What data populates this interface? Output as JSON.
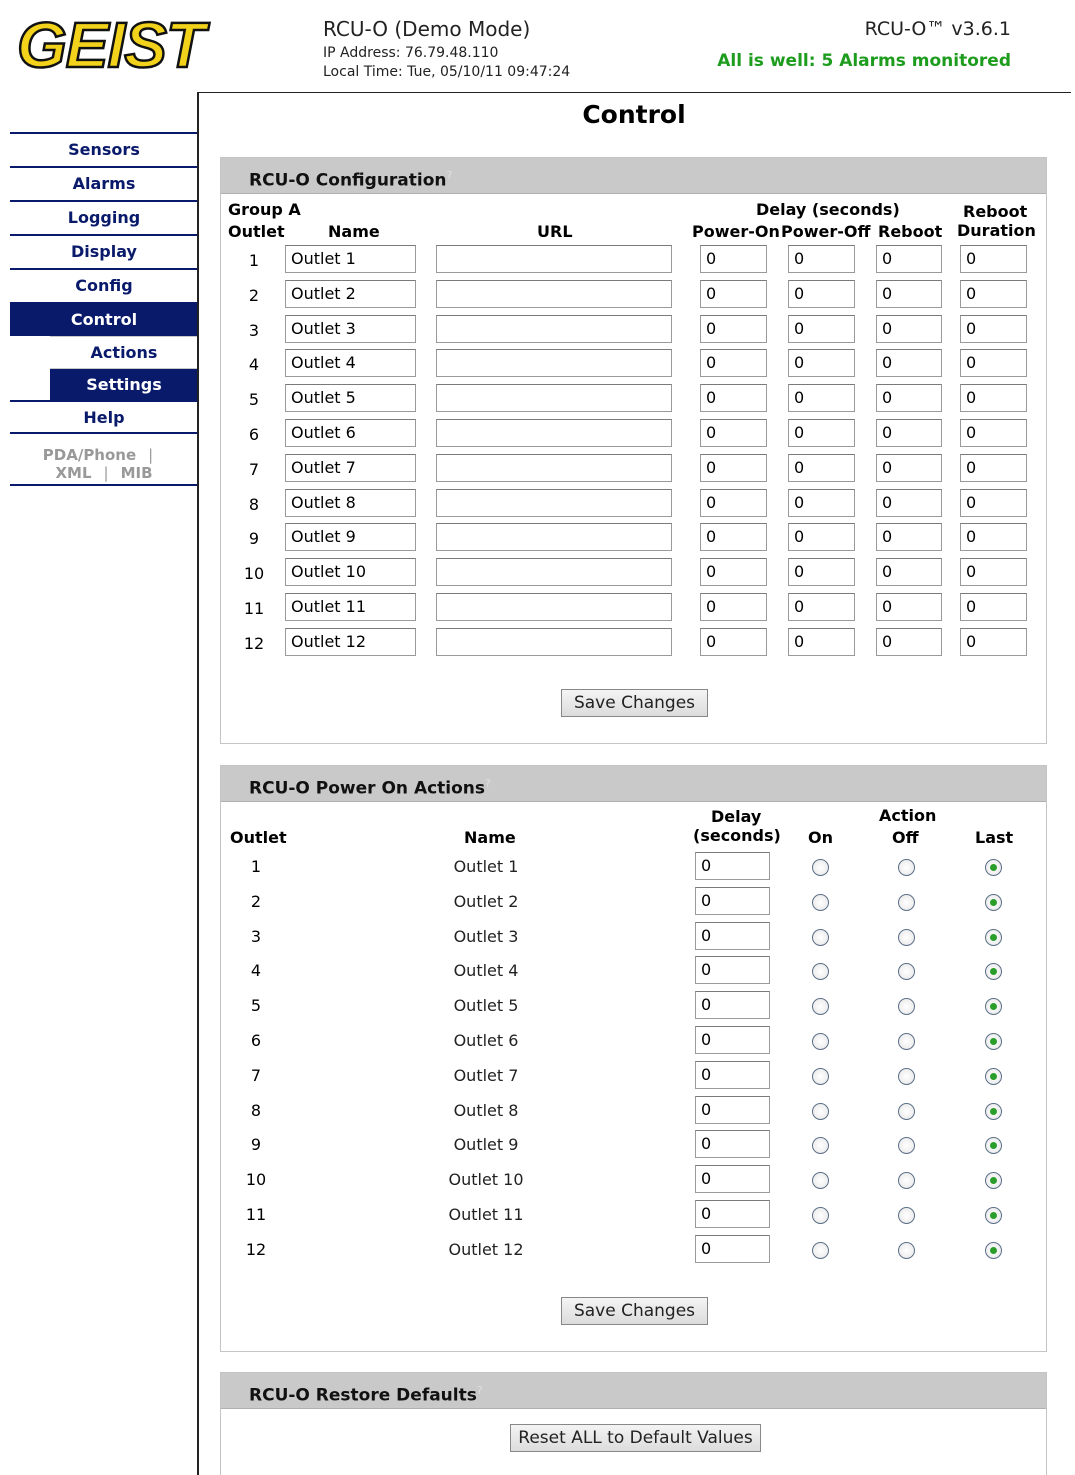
{
  "header": {
    "logo_text": "GEIST",
    "device_title": "RCU-O (Demo Mode)",
    "ip_label": "IP Address: 76.79.48.110",
    "local_time": "Local Time: Tue, 05/10/11 09:47:24",
    "version": "RCU-O™ v3.6.1",
    "status": "All is well: 5 Alarms monitored",
    "status_color": "#1e9c1e"
  },
  "nav": {
    "items": [
      "Sensors",
      "Alarms",
      "Logging",
      "Display",
      "Config",
      "Control"
    ],
    "active": "Control",
    "sub_items": [
      "Actions",
      "Settings"
    ],
    "active_sub": "Settings",
    "help": "Help",
    "pda": "PDA/Phone",
    "xml": "XML",
    "mib": "MIB",
    "sep": "|"
  },
  "page_title": "Control",
  "config": {
    "title": "RCU-O Configuration",
    "help_mark": "?",
    "headers": {
      "group": "Group A",
      "outlet": "Outlet",
      "name": "Name",
      "url": "URL",
      "delay": "Delay (seconds)",
      "power_on": "Power-On",
      "power_off": "Power-Off",
      "reboot": "Reboot",
      "reboot_dur_1": "Reboot",
      "reboot_dur_2": "Duration"
    },
    "rows": [
      {
        "num": "1",
        "name": "Outlet 1",
        "url": "",
        "on": "0",
        "off": "0",
        "reboot": "0",
        "dur": "0"
      },
      {
        "num": "2",
        "name": "Outlet 2",
        "url": "",
        "on": "0",
        "off": "0",
        "reboot": "0",
        "dur": "0"
      },
      {
        "num": "3",
        "name": "Outlet 3",
        "url": "",
        "on": "0",
        "off": "0",
        "reboot": "0",
        "dur": "0"
      },
      {
        "num": "4",
        "name": "Outlet 4",
        "url": "",
        "on": "0",
        "off": "0",
        "reboot": "0",
        "dur": "0"
      },
      {
        "num": "5",
        "name": "Outlet 5",
        "url": "",
        "on": "0",
        "off": "0",
        "reboot": "0",
        "dur": "0"
      },
      {
        "num": "6",
        "name": "Outlet 6",
        "url": "",
        "on": "0",
        "off": "0",
        "reboot": "0",
        "dur": "0"
      },
      {
        "num": "7",
        "name": "Outlet 7",
        "url": "",
        "on": "0",
        "off": "0",
        "reboot": "0",
        "dur": "0"
      },
      {
        "num": "8",
        "name": "Outlet 8",
        "url": "",
        "on": "0",
        "off": "0",
        "reboot": "0",
        "dur": "0"
      },
      {
        "num": "9",
        "name": "Outlet 9",
        "url": "",
        "on": "0",
        "off": "0",
        "reboot": "0",
        "dur": "0"
      },
      {
        "num": "10",
        "name": "Outlet 10",
        "url": "",
        "on": "0",
        "off": "0",
        "reboot": "0",
        "dur": "0"
      },
      {
        "num": "11",
        "name": "Outlet 11",
        "url": "",
        "on": "0",
        "off": "0",
        "reboot": "0",
        "dur": "0"
      },
      {
        "num": "12",
        "name": "Outlet 12",
        "url": "",
        "on": "0",
        "off": "0",
        "reboot": "0",
        "dur": "0"
      }
    ],
    "save_label": "Save Changes"
  },
  "power_on": {
    "title": "RCU-O Power On Actions",
    "help_mark": "?",
    "headers": {
      "outlet": "Outlet",
      "name": "Name",
      "delay_1": "Delay",
      "delay_2": "(seconds)",
      "action": "Action",
      "on": "On",
      "off": "Off",
      "last": "Last"
    },
    "rows": [
      {
        "num": "1",
        "name": "Outlet 1",
        "delay": "0",
        "action": "last"
      },
      {
        "num": "2",
        "name": "Outlet 2",
        "delay": "0",
        "action": "last"
      },
      {
        "num": "3",
        "name": "Outlet 3",
        "delay": "0",
        "action": "last"
      },
      {
        "num": "4",
        "name": "Outlet 4",
        "delay": "0",
        "action": "last"
      },
      {
        "num": "5",
        "name": "Outlet 5",
        "delay": "0",
        "action": "last"
      },
      {
        "num": "6",
        "name": "Outlet 6",
        "delay": "0",
        "action": "last"
      },
      {
        "num": "7",
        "name": "Outlet 7",
        "delay": "0",
        "action": "last"
      },
      {
        "num": "8",
        "name": "Outlet 8",
        "delay": "0",
        "action": "last"
      },
      {
        "num": "9",
        "name": "Outlet 9",
        "delay": "0",
        "action": "last"
      },
      {
        "num": "10",
        "name": "Outlet 10",
        "delay": "0",
        "action": "last"
      },
      {
        "num": "11",
        "name": "Outlet 11",
        "delay": "0",
        "action": "last"
      },
      {
        "num": "12",
        "name": "Outlet 12",
        "delay": "0",
        "action": "last"
      }
    ],
    "save_label": "Save Changes"
  },
  "restore": {
    "title": "RCU-O Restore Defaults",
    "help_mark": "?",
    "reset_label": "Reset ALL to Default Values"
  }
}
